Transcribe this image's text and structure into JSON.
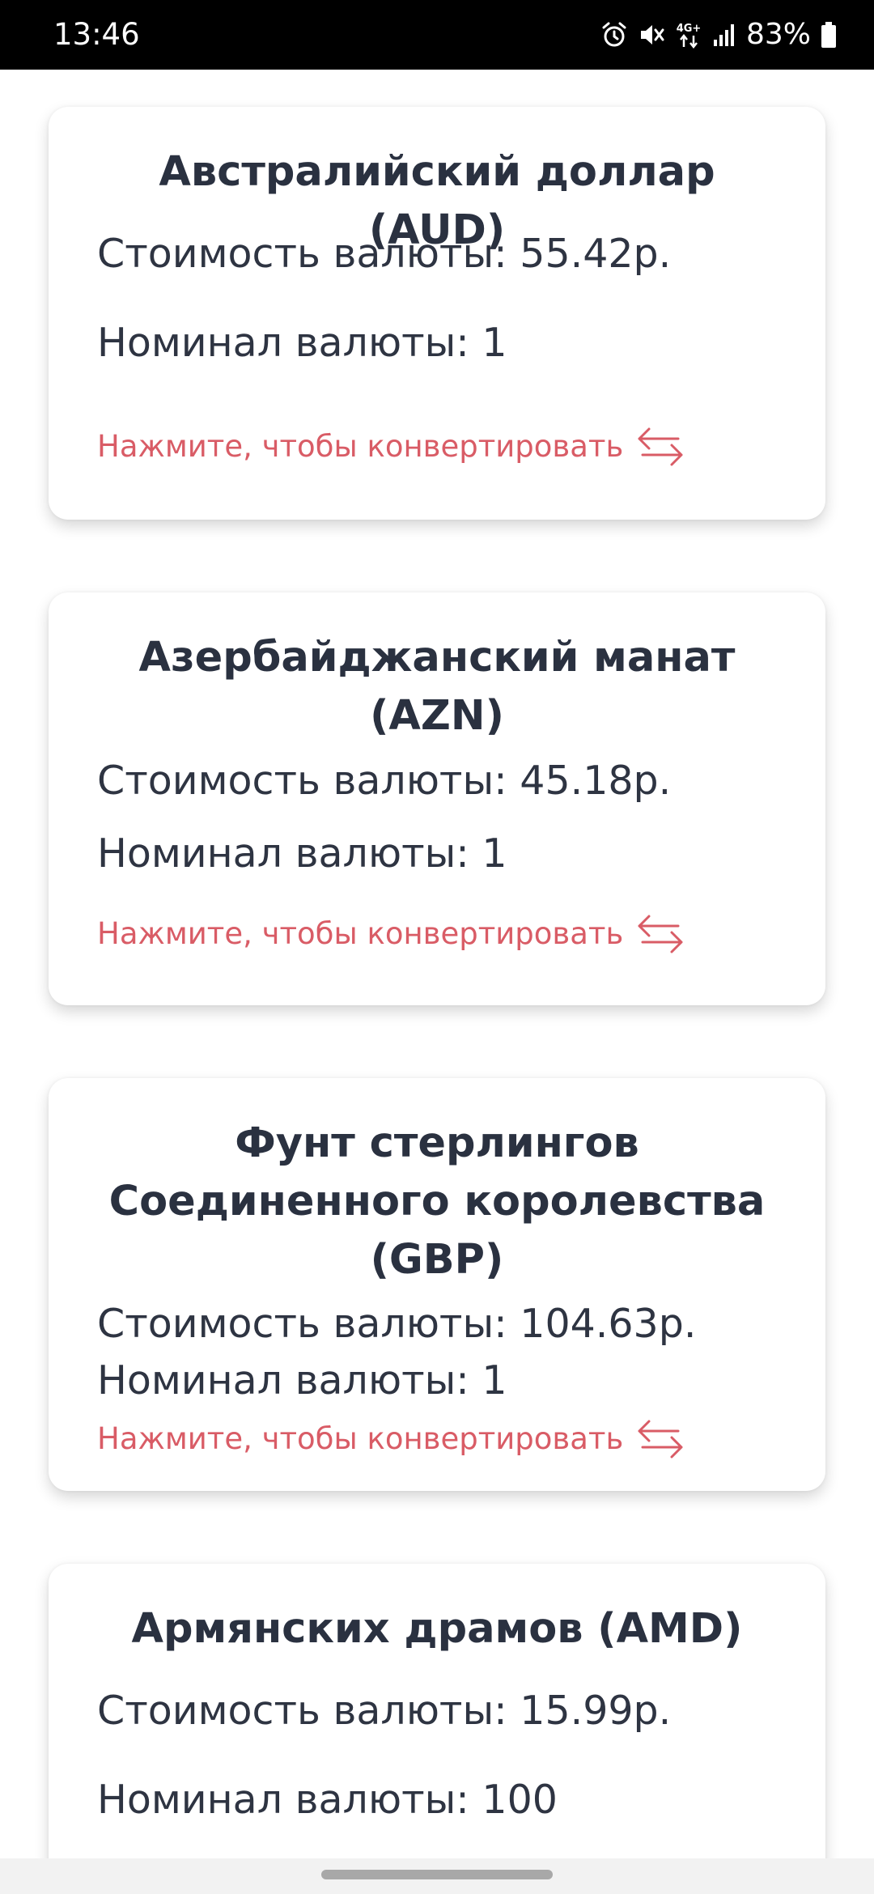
{
  "status_bar": {
    "time": "13:46",
    "network": "4G+",
    "battery": "83%",
    "icons": [
      "alarm-icon",
      "mute-icon",
      "network-4g-icon",
      "signal-icon",
      "battery-icon"
    ]
  },
  "colors": {
    "title": "#2a3140",
    "text": "#2e3442",
    "accent": "#d95c66",
    "status_bar": "#000000"
  },
  "currencies": [
    {
      "title": "Австралийский доллар (AUD)",
      "price_label": "Стоимость валюты: ",
      "price": "55.42р.",
      "nominal_label": "Номинал валюты: ",
      "nominal": "1",
      "convert_label": "Нажмите, чтобы конвертировать",
      "convert_icon": "exchange-arrows-icon"
    },
    {
      "title": "Азербайджанский манат (AZN)",
      "price_label": "Стоимость валюты: ",
      "price": "45.18р.",
      "nominal_label": "Номинал валюты: ",
      "nominal": "1",
      "convert_label": "Нажмите, чтобы конвертировать",
      "convert_icon": "exchange-arrows-icon"
    },
    {
      "title": "Фунт стерлингов Соединенного королевства (GBP)",
      "price_label": "Стоимость валюты: ",
      "price": "104.63р.",
      "nominal_label": "Номинал валюты: ",
      "nominal": "1",
      "convert_label": "Нажмите, чтобы конвертировать",
      "convert_icon": "exchange-arrows-icon"
    },
    {
      "title": "Армянских драмов (AMD)",
      "price_label": "Стоимость валюты: ",
      "price": "15.99р.",
      "nominal_label": "Номинал валюты: ",
      "nominal": "100"
    }
  ]
}
